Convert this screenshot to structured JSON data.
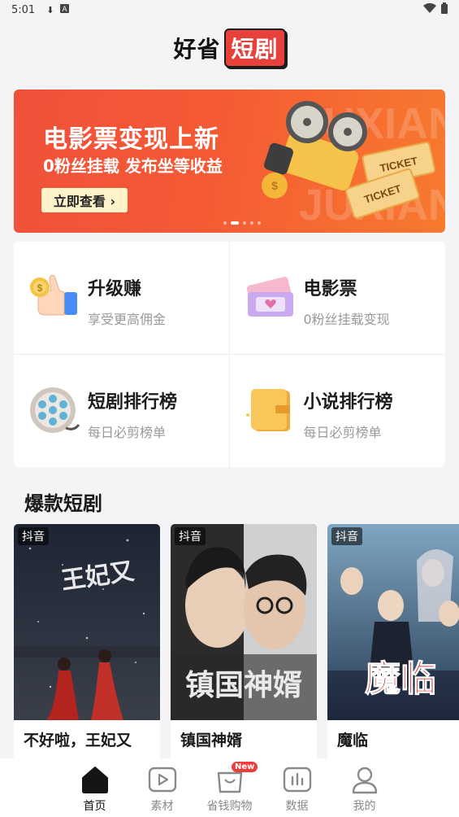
{
  "status_bar": {
    "time": "5:01"
  },
  "header": {
    "logo_plain": "好省",
    "logo_boxed": "短剧"
  },
  "banner": {
    "title": "电影票变现上新",
    "subtitle": "0粉丝挂载 发布坐等收益",
    "cta": "立即查看 ›",
    "ticket_text": "TICKET",
    "page_count": 5,
    "active_index": 1
  },
  "features": [
    {
      "title": "升级赚",
      "subtitle": "享受更高佣金",
      "icon": "thumbs-up-coin-icon"
    },
    {
      "title": "电影票",
      "subtitle": "0粉丝挂载变现",
      "icon": "movie-ticket-icon"
    },
    {
      "title": "短剧排行榜",
      "subtitle": "每日必剪榜单",
      "icon": "film-reel-icon"
    },
    {
      "title": "小说排行榜",
      "subtitle": "每日必剪榜单",
      "icon": "book-icon"
    }
  ],
  "section": {
    "title": "爆款短剧"
  },
  "dramas": [
    {
      "platform": "抖音",
      "title": "不好啦，王妃又",
      "poster_text": "王妃又"
    },
    {
      "platform": "抖音",
      "title": "镇国神婿",
      "poster_text": "镇国神婿"
    },
    {
      "platform": "抖音",
      "title": "魔临",
      "poster_text": "魔临"
    }
  ],
  "nav": [
    {
      "label": "首页",
      "icon": "home-icon",
      "active": true
    },
    {
      "label": "素材",
      "icon": "video-play-icon",
      "active": false
    },
    {
      "label": "省钱购物",
      "icon": "shopping-bag-icon",
      "active": false,
      "badge": "New"
    },
    {
      "label": "数据",
      "icon": "bar-chart-icon",
      "active": false
    },
    {
      "label": "我的",
      "icon": "person-icon",
      "active": false
    }
  ],
  "colors": {
    "brand_red": "#e8413c",
    "banner_orange": "#f45a35",
    "badge_red": "#f03c3c"
  }
}
